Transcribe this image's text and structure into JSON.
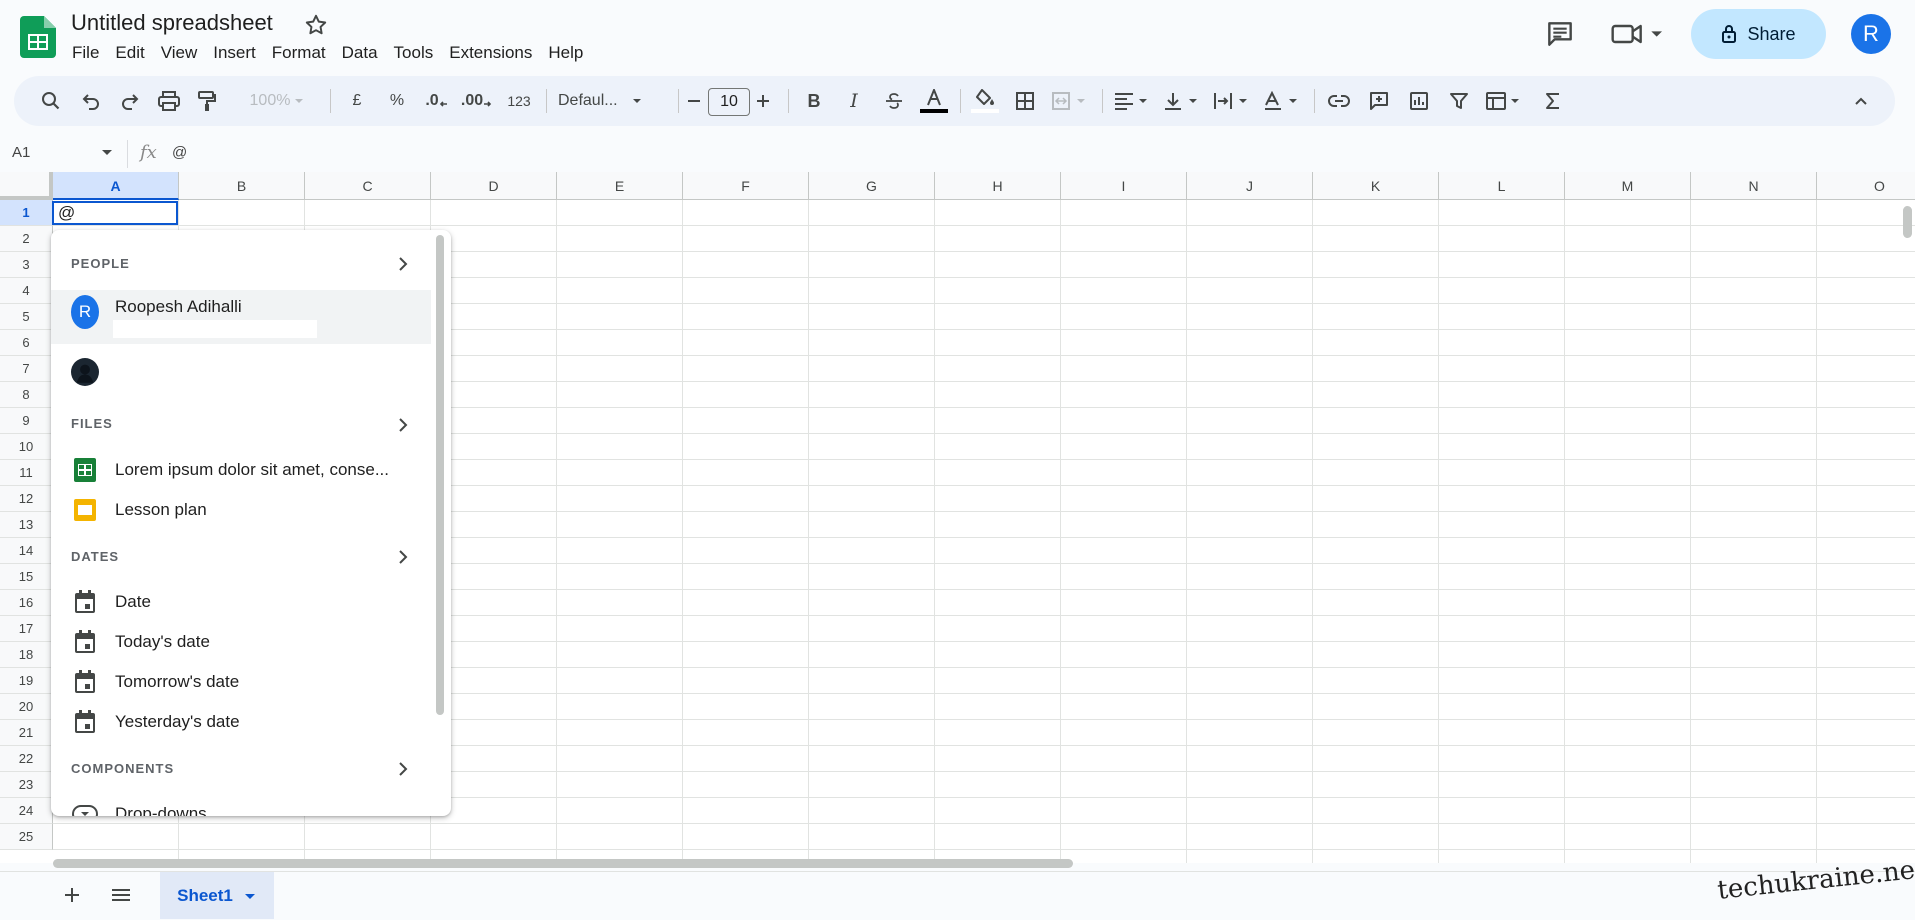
{
  "header": {
    "title": "Untitled spreadsheet",
    "menu": [
      "File",
      "Edit",
      "View",
      "Insert",
      "Format",
      "Data",
      "Tools",
      "Extensions",
      "Help"
    ],
    "share_label": "Share",
    "avatar_letter": "R"
  },
  "toolbar": {
    "zoom": "100%",
    "currency_symbol": "£",
    "percent_symbol": "%",
    "decrease_decimal": ".0",
    "increase_decimal": ".00",
    "number_format": "123",
    "font_name": "Defaul...",
    "font_size": "10",
    "text_color": "#000000"
  },
  "formula_bar": {
    "cell_ref": "A1",
    "value": "@"
  },
  "grid": {
    "columns": [
      "A",
      "B",
      "C",
      "D",
      "E",
      "F",
      "G",
      "H",
      "I",
      "J",
      "K",
      "L",
      "M",
      "N",
      "O"
    ],
    "rows": [
      "1",
      "2",
      "3",
      "4",
      "5",
      "6",
      "7",
      "8",
      "9",
      "10",
      "11",
      "12",
      "13",
      "14",
      "15",
      "16",
      "17",
      "18",
      "19",
      "20",
      "21",
      "22",
      "23",
      "24",
      "25"
    ],
    "selected_column": "A",
    "selected_row": "1",
    "active_cell_value": "@"
  },
  "smart_chips": {
    "people_heading": "PEOPLE",
    "people": [
      {
        "name": "Roopesh Adihalli",
        "initial": "R"
      }
    ],
    "files_heading": "FILES",
    "files": [
      {
        "name": "Lorem ipsum dolor sit amet, conse...",
        "icon": "google-sheets-icon"
      },
      {
        "name": "Lesson plan",
        "icon": "google-slides-icon"
      }
    ],
    "dates_heading": "DATES",
    "dates": [
      "Date",
      "Today's date",
      "Tomorrow's date",
      "Yesterday's date"
    ],
    "components_heading": "COMPONENTS",
    "components": [
      "Drop-downs"
    ]
  },
  "sheets": {
    "tabs": [
      "Sheet1"
    ]
  },
  "watermark": "techukraine.net",
  "colors": {
    "accent": "#0b57d0",
    "share_bg": "#c2e7ff",
    "sheets_green": "#188038",
    "slides_yellow": "#f4b400",
    "toolbar_bg": "#edf2fa"
  }
}
